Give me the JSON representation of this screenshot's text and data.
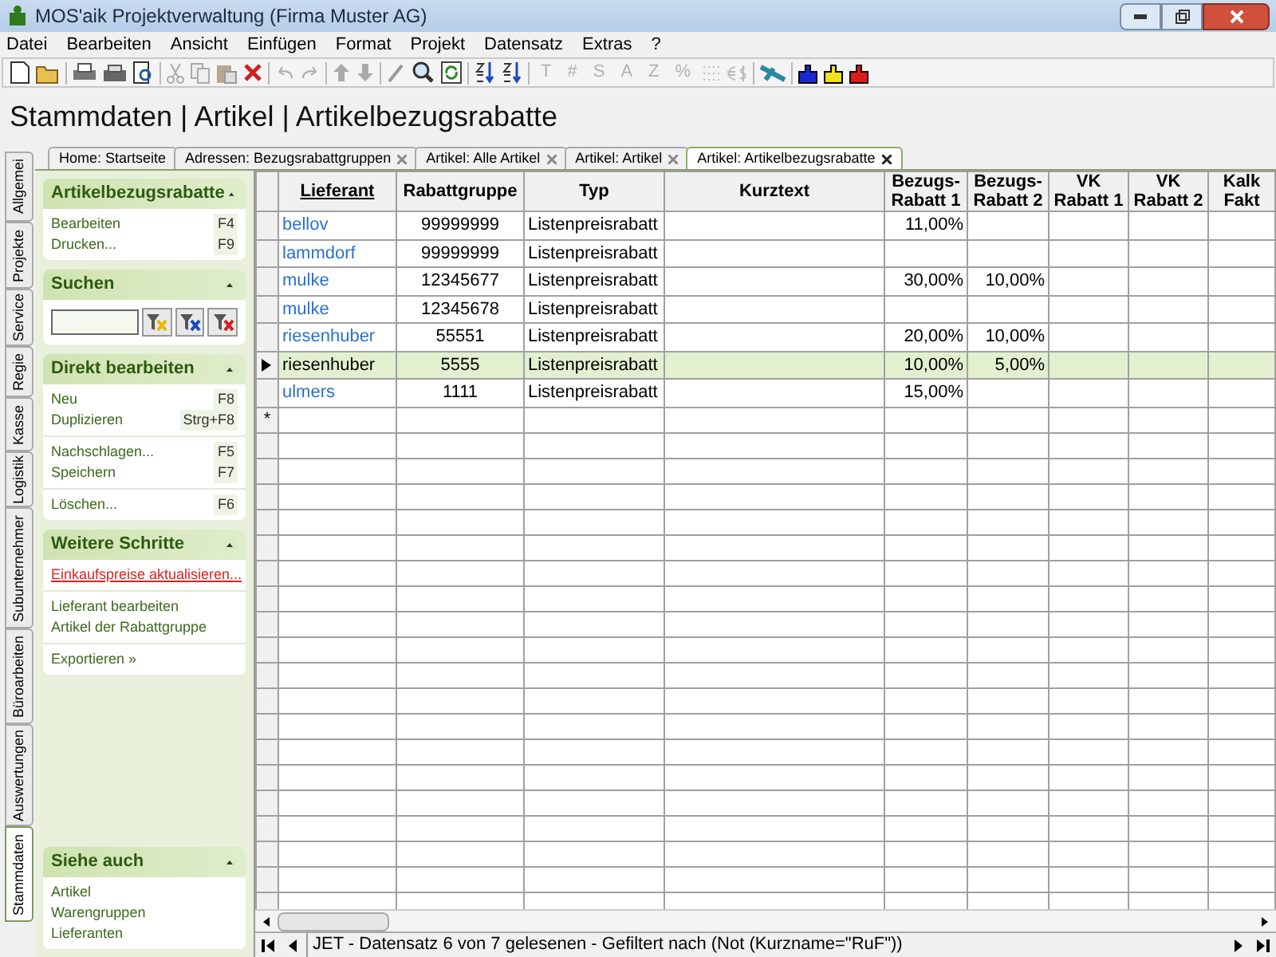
{
  "window": {
    "title": "MOS'aik Projektverwaltung (Firma Muster AG)"
  },
  "menu": [
    "Datei",
    "Bearbeiten",
    "Ansicht",
    "Einfügen",
    "Format",
    "Projekt",
    "Datensatz",
    "Extras",
    "?"
  ],
  "toolbar_glyphs": [
    {
      "text": "T",
      "disabled": true
    },
    {
      "text": "#",
      "disabled": true
    },
    {
      "text": "S",
      "disabled": true
    },
    {
      "text": "A",
      "disabled": true
    },
    {
      "text": "Z",
      "disabled": true
    },
    {
      "text": "%",
      "disabled": true
    }
  ],
  "heading": "Stammdaten | Artikel | Artikelbezugsrabatte",
  "tabs": [
    {
      "label": "Home: Startseite",
      "closable": false,
      "selected": false
    },
    {
      "label": "Adressen: Bezugsrabattgruppen",
      "closable": true,
      "selected": false
    },
    {
      "label": "Artikel: Alle Artikel",
      "closable": true,
      "selected": false
    },
    {
      "label": "Artikel: Artikel",
      "closable": true,
      "selected": false
    },
    {
      "label": "Artikel: Artikelbezugsrabatte",
      "closable": true,
      "selected": true
    }
  ],
  "side_tabs": [
    {
      "label": "Allgemei",
      "selected": false
    },
    {
      "label": "Projekte",
      "selected": false
    },
    {
      "label": "Service",
      "selected": false
    },
    {
      "label": "Regie",
      "selected": false
    },
    {
      "label": "Kasse",
      "selected": false
    },
    {
      "label": "Logistik",
      "selected": false
    },
    {
      "label": "Subunternehmer",
      "selected": false
    },
    {
      "label": "Büroarbeiten",
      "selected": false
    },
    {
      "label": "Auswertungen",
      "selected": false
    },
    {
      "label": "Stammdaten",
      "selected": true
    }
  ],
  "sidebar": {
    "sections": [
      {
        "title": "Artikelbezugsrabatte",
        "kind": "list",
        "expanded": true,
        "groups": [
          [
            {
              "label": "Bearbeiten",
              "shortcut": "F4"
            },
            {
              "label": "Drucken...",
              "shortcut": "F9"
            }
          ]
        ]
      },
      {
        "title": "Suchen",
        "kind": "search",
        "expanded": true
      },
      {
        "title": "Direkt bearbeiten",
        "kind": "list",
        "expanded": true,
        "groups": [
          [
            {
              "label": "Neu",
              "shortcut": "F8"
            },
            {
              "label": "Duplizieren",
              "shortcut": "Strg+F8"
            }
          ],
          [
            {
              "label": "Nachschlagen...",
              "shortcut": "F5"
            },
            {
              "label": "Speichern",
              "shortcut": "F7"
            }
          ],
          [
            {
              "label": "Löschen...",
              "shortcut": "F6"
            }
          ]
        ]
      },
      {
        "title": "Weitere Schritte",
        "kind": "list",
        "expanded": true,
        "groups": [
          [
            {
              "label": "Einkaufspreise aktualisieren...",
              "alert": true
            }
          ],
          [
            {
              "label": "Lieferant bearbeiten"
            },
            {
              "label": "Artikel der Rabattgruppe"
            }
          ],
          [
            {
              "label": "Exportieren »"
            }
          ]
        ]
      },
      {
        "title": "Siehe auch",
        "kind": "list",
        "expanded": true,
        "groups": [
          [
            {
              "label": "Artikel"
            },
            {
              "label": "Warengruppen"
            },
            {
              "label": "Lieferanten"
            }
          ]
        ]
      }
    ]
  },
  "table": {
    "columns": [
      {
        "label": "Lieferant",
        "sorted": true
      },
      {
        "label": "Rabattgruppe",
        "sorted": false
      },
      {
        "label": "Typ",
        "sorted": false
      },
      {
        "label": "Kurztext",
        "sorted": false
      },
      {
        "label": "Bezugs-\nRabatt 1",
        "sorted": false
      },
      {
        "label": "Bezugs-\nRabatt 2",
        "sorted": false
      },
      {
        "label": "VK\nRabatt 1",
        "sorted": false
      },
      {
        "label": "VK\nRabatt 2",
        "sorted": false
      },
      {
        "label": "Kalk\nFakt",
        "sorted": false
      }
    ],
    "rows": [
      {
        "selected": false,
        "cells": {
          "lieferant": "bellov",
          "rabattgruppe": "99999999",
          "typ": "Listenpreisrabatt",
          "bezugs_rabatt_1": "11,00%"
        }
      },
      {
        "selected": false,
        "cells": {
          "lieferant": "lammdorf",
          "rabattgruppe": "99999999",
          "typ": "Listenpreisrabatt"
        }
      },
      {
        "selected": false,
        "cells": {
          "lieferant": "mulke",
          "rabattgruppe": "12345677",
          "typ": "Listenpreisrabatt",
          "bezugs_rabatt_1": "30,00%",
          "bezugs_rabatt_2": "10,00%"
        }
      },
      {
        "selected": false,
        "cells": {
          "lieferant": "mulke",
          "rabattgruppe": "12345678",
          "typ": "Listenpreisrabatt"
        }
      },
      {
        "selected": false,
        "cells": {
          "lieferant": "riesenhuber",
          "rabattgruppe": "55551",
          "typ": "Listenpreisrabatt",
          "bezugs_rabatt_1": "20,00%",
          "bezugs_rabatt_2": "10,00%"
        }
      },
      {
        "selected": true,
        "cells": {
          "lieferant": "riesenhuber",
          "rabattgruppe": "5555",
          "typ": "Listenpreisrabatt",
          "bezugs_rabatt_1": "10,00%",
          "bezugs_rabatt_2": "5,00%"
        }
      },
      {
        "selected": false,
        "cells": {
          "lieferant": "ulmers",
          "rabattgruppe": "1111",
          "typ": "Listenpreisrabatt",
          "bezugs_rabatt_1": "15,00%"
        }
      }
    ],
    "new_row_marker": "*"
  },
  "status_bar": "JET - Datensatz 6 von 7 gelesenen - Gefiltert nach (Not (Kurzname=\"RuF\"))"
}
